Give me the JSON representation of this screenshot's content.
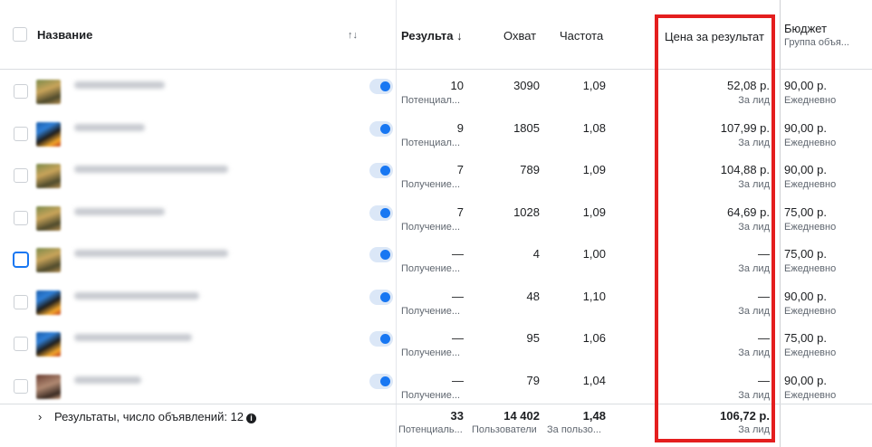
{
  "header": {
    "name_label": "Название",
    "results_label": "Результа ↓",
    "reach_label": "Охват",
    "frequency_label": "Частота",
    "cost_label": "Цена за результат",
    "budget_label": "Бюджет",
    "budget_sub": "Группа объя..."
  },
  "rows": [
    {
      "thumb": "a",
      "results": "10",
      "results_type": "Потенциал...",
      "reach": "3090",
      "frequency": "1,09",
      "cost": "52,08 р.",
      "cost_sub": "За лид",
      "budget": "90,00 р.",
      "budget_sub": "Ежедневно"
    },
    {
      "thumb": "b",
      "results": "9",
      "results_type": "Потенциал...",
      "reach": "1805",
      "frequency": "1,08",
      "cost": "107,99 р.",
      "cost_sub": "За лид",
      "budget": "90,00 р.",
      "budget_sub": "Ежедневно"
    },
    {
      "thumb": "a",
      "results": "7",
      "results_type": "Получение...",
      "reach": "789",
      "frequency": "1,09",
      "cost": "104,88 р.",
      "cost_sub": "За лид",
      "budget": "90,00 р.",
      "budget_sub": "Ежедневно"
    },
    {
      "thumb": "a",
      "results": "7",
      "results_type": "Получение...",
      "reach": "1028",
      "frequency": "1,09",
      "cost": "64,69 р.",
      "cost_sub": "За лид",
      "budget": "75,00 р.",
      "budget_sub": "Ежедневно"
    },
    {
      "thumb": "a",
      "results": "—",
      "results_type": "Получение...",
      "reach": "4",
      "frequency": "1,00",
      "cost": "—",
      "cost_sub": "За лид",
      "budget": "75,00 р.",
      "budget_sub": "Ежедневно"
    },
    {
      "thumb": "b",
      "results": "—",
      "results_type": "Получение...",
      "reach": "48",
      "frequency": "1,10",
      "cost": "—",
      "cost_sub": "За лид",
      "budget": "90,00 р.",
      "budget_sub": "Ежедневно"
    },
    {
      "thumb": "b",
      "results": "—",
      "results_type": "Получение...",
      "reach": "95",
      "frequency": "1,06",
      "cost": "—",
      "cost_sub": "За лид",
      "budget": "75,00 р.",
      "budget_sub": "Ежедневно"
    },
    {
      "thumb": "c",
      "results": "—",
      "results_type": "Получение...",
      "reach": "79",
      "frequency": "1,04",
      "cost": "—",
      "cost_sub": "За лид",
      "budget": "90,00 р.",
      "budget_sub": "Ежедневно"
    }
  ],
  "footer": {
    "summary_label": "Результаты, число объявлений: 12",
    "results": "33",
    "results_sub": "Потенциаль...",
    "reach": "14 402",
    "reach_sub": "Пользователи",
    "frequency": "1,48",
    "frequency_sub": "За пользо...",
    "cost": "106,72 р.",
    "cost_sub": "За лид"
  },
  "colors": {
    "accent": "#1877f2",
    "highlight": "#e41e1e"
  }
}
